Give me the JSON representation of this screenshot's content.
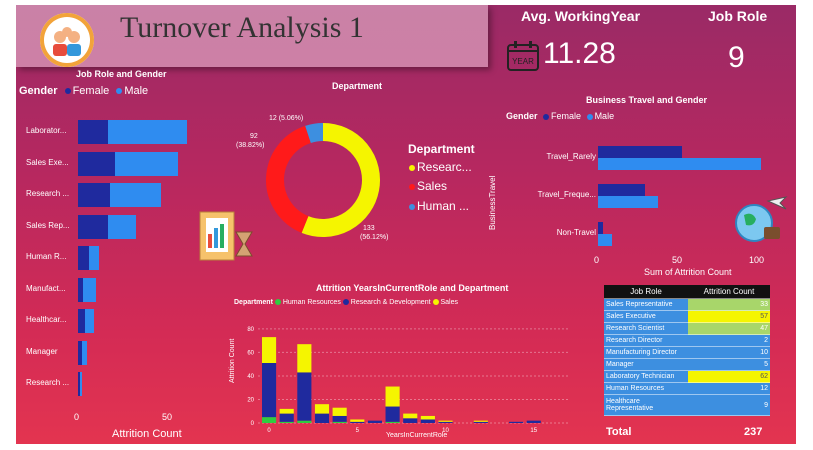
{
  "header": {
    "title": "Turnover Analysis 1"
  },
  "kpis": {
    "avg_working_year_label": "Avg. WorkingYear",
    "avg_working_year_value": "11.28",
    "year_icon_text": "YEAR",
    "job_role_label": "Job Role",
    "job_role_value": "9"
  },
  "job_role_gender": {
    "title": "Job Role and Gender",
    "legend_title": "Gender",
    "legend_female": "Female",
    "legend_male": "Male",
    "xlabel": "Attrition Count",
    "ticks": [
      "0",
      "50"
    ],
    "categories": [
      "Laborator...",
      "Sales Exe...",
      "Research ...",
      "Sales Rep...",
      "Human R...",
      "Manufact...",
      "Healthcar...",
      "Manager",
      "Research ..."
    ]
  },
  "department": {
    "title": "Department",
    "legend_title": "Department",
    "legend": [
      "Researc...",
      "Sales",
      "Human ..."
    ],
    "label_rd": "133",
    "label_rd_pct": "(56.12%)",
    "label_sales": "92",
    "label_sales_pct": "(38.82%)",
    "label_hr": "12 (5.06%)"
  },
  "business_travel": {
    "title": "Business Travel and Gender",
    "legend_title": "Gender",
    "legend_female": "Female",
    "legend_male": "Male",
    "ylabel": "BusinessTravel",
    "xlabel": "Sum of Attrition Count",
    "categories": [
      "Travel_Rarely",
      "Travel_Freque...",
      "Non-Travel"
    ],
    "ticks": [
      "0",
      "50",
      "100"
    ]
  },
  "attrition_years": {
    "title": "Attrition YearsInCurrentRole and Department",
    "legend_title": "Department",
    "legend": [
      "Human Resources",
      "Research & Development",
      "Sales"
    ],
    "ylabel": "Attrition Count",
    "xlabel": "YearsInCurrentRole",
    "yticks": [
      "80",
      "60",
      "40",
      "20",
      "0"
    ],
    "xticks": [
      "0",
      "5",
      "10",
      "15"
    ]
  },
  "table": {
    "col1": "Job Role",
    "col2": "Attrition Count",
    "rows": [
      {
        "role": "Sales Representative",
        "count": "33"
      },
      {
        "role": "Sales Executive",
        "count": "57"
      },
      {
        "role": "Research Scientist",
        "count": "47"
      },
      {
        "role": "Research Director",
        "count": "2"
      },
      {
        "role": "Manufacturing Director",
        "count": "10"
      },
      {
        "role": "Manager",
        "count": "5"
      },
      {
        "role": "Laboratory Technician",
        "count": "62"
      },
      {
        "role": "Human Resources",
        "count": "12"
      },
      {
        "role": "Healthcare Representative",
        "count": "9"
      }
    ],
    "total_label": "Total",
    "total_value": "237"
  },
  "chart_data": [
    {
      "type": "bar",
      "title": "Job Role and Gender",
      "categories": [
        "Laborator...",
        "Sales Exe...",
        "Research ...",
        "Sales Rep...",
        "Human R...",
        "Manufact...",
        "Healthcar...",
        "Manager",
        "Research ..."
      ],
      "series": [
        {
          "name": "Female",
          "values": [
            17,
            21,
            18,
            17,
            6,
            3,
            4,
            2,
            1
          ]
        },
        {
          "name": "Male",
          "values": [
            45,
            36,
            29,
            16,
            6,
            7,
            5,
            3,
            1
          ]
        }
      ],
      "xlabel": "Attrition Count",
      "xlim": [
        0,
        65
      ]
    },
    {
      "type": "pie",
      "title": "Department",
      "categories": [
        "Research & Development",
        "Sales",
        "Human Resources"
      ],
      "values": [
        133,
        92,
        12
      ]
    },
    {
      "type": "bar",
      "title": "Business Travel and Gender",
      "categories": [
        "Travel_Rarely",
        "Travel_Freque...",
        "Non-Travel"
      ],
      "series": [
        {
          "name": "Female",
          "values": [
            53,
            30,
            3
          ]
        },
        {
          "name": "Male",
          "values": [
            103,
            38,
            9
          ]
        }
      ],
      "xlabel": "Sum of Attrition Count",
      "ylabel": "BusinessTravel",
      "xlim": [
        0,
        110
      ]
    },
    {
      "type": "bar",
      "title": "Attrition YearsInCurrentRole and Department",
      "x": [
        0,
        1,
        2,
        3,
        4,
        5,
        6,
        7,
        8,
        9,
        10,
        11,
        12,
        13,
        14,
        15
      ],
      "series": [
        {
          "name": "Human Resources",
          "values": [
            5,
            1,
            2,
            0,
            1,
            0,
            0,
            1,
            0,
            0,
            0,
            0,
            0,
            0,
            0,
            0
          ]
        },
        {
          "name": "Research & Development",
          "values": [
            46,
            7,
            41,
            8,
            5,
            1,
            2,
            13,
            4,
            3,
            1,
            0,
            1,
            0,
            1,
            2
          ]
        },
        {
          "name": "Sales",
          "values": [
            22,
            4,
            24,
            8,
            7,
            2,
            0,
            17,
            4,
            3,
            1,
            0,
            1,
            0,
            0,
            0
          ]
        }
      ],
      "xlabel": "YearsInCurrentRole",
      "ylabel": "Attrition Count",
      "ylim": [
        0,
        85
      ]
    }
  ]
}
